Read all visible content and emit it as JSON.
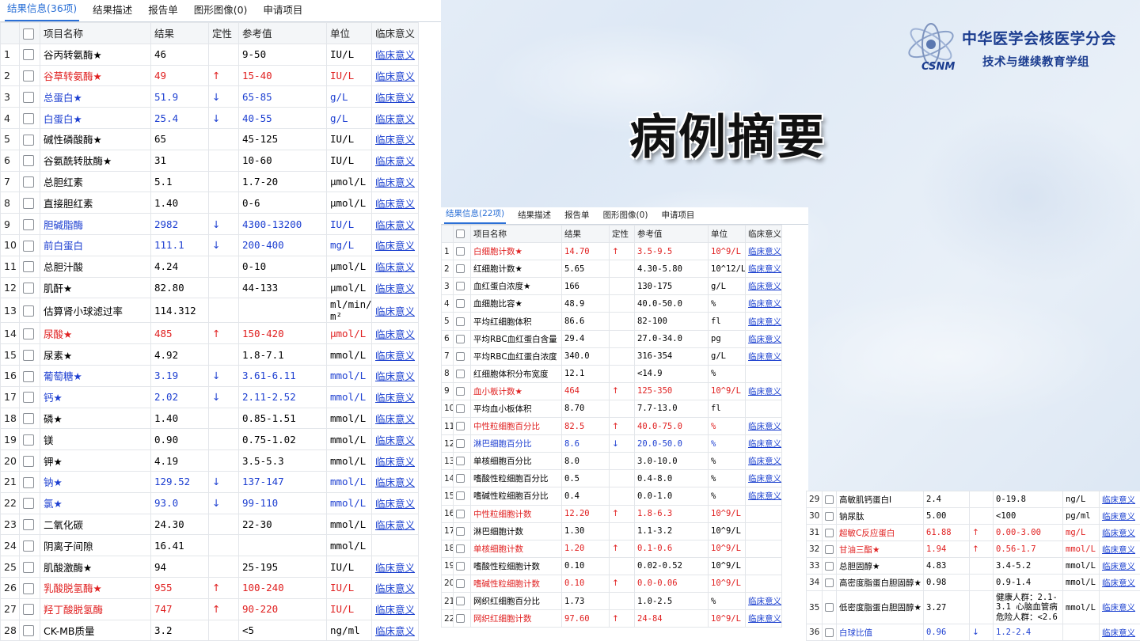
{
  "slide": {
    "title": "病例摘要",
    "org_line1": "中华医学会核医学分会",
    "org_line2": "技术与继续教育学组",
    "logo_text": "CSNM"
  },
  "p1": {
    "tabs": [
      "结果信息(36项)",
      "结果描述",
      "报告单",
      "图形图像(0)",
      "申请项目"
    ],
    "headers": [
      "项目名称",
      "结果",
      "定性",
      "参考值",
      "单位",
      "临床意义"
    ],
    "rows": [
      {
        "n": "1",
        "name": "谷丙转氨酶★",
        "result": "46",
        "flag": "",
        "ref": "9-50",
        "unit": "IU/L",
        "link": "临床意义",
        "color": ""
      },
      {
        "n": "2",
        "name": "谷草转氨酶★",
        "result": "49",
        "flag": "↑",
        "ref": "15-40",
        "unit": "IU/L",
        "link": "临床意义",
        "color": "red"
      },
      {
        "n": "3",
        "name": "总蛋白★",
        "result": "51.9",
        "flag": "↓",
        "ref": "65-85",
        "unit": "g/L",
        "link": "临床意义",
        "color": "blue"
      },
      {
        "n": "4",
        "name": "白蛋白★",
        "result": "25.4",
        "flag": "↓",
        "ref": "40-55",
        "unit": "g/L",
        "link": "临床意义",
        "color": "blue"
      },
      {
        "n": "5",
        "name": "碱性磷酸酶★",
        "result": "65",
        "flag": "",
        "ref": "45-125",
        "unit": "IU/L",
        "link": "临床意义",
        "color": ""
      },
      {
        "n": "6",
        "name": "谷氨酰转肽酶★",
        "result": "31",
        "flag": "",
        "ref": "10-60",
        "unit": "IU/L",
        "link": "临床意义",
        "color": ""
      },
      {
        "n": "7",
        "name": "总胆红素",
        "result": "5.1",
        "flag": "",
        "ref": "1.7-20",
        "unit": "μmol/L",
        "link": "临床意义",
        "color": ""
      },
      {
        "n": "8",
        "name": "直接胆红素",
        "result": "1.40",
        "flag": "",
        "ref": "0-6",
        "unit": "μmol/L",
        "link": "临床意义",
        "color": ""
      },
      {
        "n": "9",
        "name": "胆碱脂酶",
        "result": "2982",
        "flag": "↓",
        "ref": "4300-13200",
        "unit": "IU/L",
        "link": "临床意义",
        "color": "blue"
      },
      {
        "n": "10",
        "name": "前白蛋白",
        "result": "111.1",
        "flag": "↓",
        "ref": "200-400",
        "unit": "mg/L",
        "link": "临床意义",
        "color": "blue"
      },
      {
        "n": "11",
        "name": "总胆汁酸",
        "result": "4.24",
        "flag": "",
        "ref": "0-10",
        "unit": "μmol/L",
        "link": "临床意义",
        "color": ""
      },
      {
        "n": "12",
        "name": "肌酐★",
        "result": "82.80",
        "flag": "",
        "ref": "44-133",
        "unit": "μmol/L",
        "link": "临床意义",
        "color": ""
      },
      {
        "n": "13",
        "name": "估算肾小球滤过率",
        "result": "114.312",
        "flag": "",
        "ref": "",
        "unit": "ml/min/1 m²",
        "link": "临床意义",
        "color": ""
      },
      {
        "n": "14",
        "name": "尿酸★",
        "result": "485",
        "flag": "↑",
        "ref": "150-420",
        "unit": "μmol/L",
        "link": "临床意义",
        "color": "red"
      },
      {
        "n": "15",
        "name": "尿素★",
        "result": "4.92",
        "flag": "",
        "ref": "1.8-7.1",
        "unit": "mmol/L",
        "link": "临床意义",
        "color": ""
      },
      {
        "n": "16",
        "name": "葡萄糖★",
        "result": "3.19",
        "flag": "↓",
        "ref": "3.61-6.11",
        "unit": "mmol/L",
        "link": "临床意义",
        "color": "blue"
      },
      {
        "n": "17",
        "name": "钙★",
        "result": "2.02",
        "flag": "↓",
        "ref": "2.11-2.52",
        "unit": "mmol/L",
        "link": "临床意义",
        "color": "blue"
      },
      {
        "n": "18",
        "name": "磷★",
        "result": "1.40",
        "flag": "",
        "ref": "0.85-1.51",
        "unit": "mmol/L",
        "link": "临床意义",
        "color": ""
      },
      {
        "n": "19",
        "name": "镁",
        "result": "0.90",
        "flag": "",
        "ref": "0.75-1.02",
        "unit": "mmol/L",
        "link": "临床意义",
        "color": ""
      },
      {
        "n": "20",
        "name": "钾★",
        "result": "4.19",
        "flag": "",
        "ref": "3.5-5.3",
        "unit": "mmol/L",
        "link": "临床意义",
        "color": ""
      },
      {
        "n": "21",
        "name": "钠★",
        "result": "129.52",
        "flag": "↓",
        "ref": "137-147",
        "unit": "mmol/L",
        "link": "临床意义",
        "color": "blue"
      },
      {
        "n": "22",
        "name": "氯★",
        "result": "93.0",
        "flag": "↓",
        "ref": "99-110",
        "unit": "mmol/L",
        "link": "临床意义",
        "color": "blue"
      },
      {
        "n": "23",
        "name": "二氧化碳",
        "result": "24.30",
        "flag": "",
        "ref": "22-30",
        "unit": "mmol/L",
        "link": "临床意义",
        "color": ""
      },
      {
        "n": "24",
        "name": "阴离子间隙",
        "result": "16.41",
        "flag": "",
        "ref": "",
        "unit": "mmol/L",
        "link": "",
        "color": ""
      },
      {
        "n": "25",
        "name": "肌酸激酶★",
        "result": "94",
        "flag": "",
        "ref": "25-195",
        "unit": "IU/L",
        "link": "临床意义",
        "color": ""
      },
      {
        "n": "26",
        "name": "乳酸脱氢酶★",
        "result": "955",
        "flag": "↑",
        "ref": "100-240",
        "unit": "IU/L",
        "link": "临床意义",
        "color": "red"
      },
      {
        "n": "27",
        "name": "羟丁酸脱氢酶",
        "result": "747",
        "flag": "↑",
        "ref": "90-220",
        "unit": "IU/L",
        "link": "临床意义",
        "color": "red"
      },
      {
        "n": "28",
        "name": "CK-MB质量",
        "result": "3.2",
        "flag": "",
        "ref": "<5",
        "unit": "ng/ml",
        "link": "临床意义",
        "color": ""
      }
    ]
  },
  "p2": {
    "tabs": [
      "结果信息(22项)",
      "结果描述",
      "报告单",
      "图形图像(0)",
      "申请项目"
    ],
    "headers": [
      "项目名称",
      "结果",
      "定性",
      "参考值",
      "单位",
      "临床意义"
    ],
    "rows": [
      {
        "n": "1",
        "name": "白细胞计数★",
        "result": "14.70",
        "flag": "↑",
        "ref": "3.5-9.5",
        "unit": "10^9/L",
        "link": "临床意义",
        "color": "red"
      },
      {
        "n": "2",
        "name": "红细胞计数★",
        "result": "5.65",
        "flag": "",
        "ref": "4.30-5.80",
        "unit": "10^12/L",
        "link": "临床意义",
        "color": ""
      },
      {
        "n": "3",
        "name": "血红蛋白浓度★",
        "result": "166",
        "flag": "",
        "ref": "130-175",
        "unit": "g/L",
        "link": "临床意义",
        "color": ""
      },
      {
        "n": "4",
        "name": "血细胞比容★",
        "result": "48.9",
        "flag": "",
        "ref": "40.0-50.0",
        "unit": "%",
        "link": "临床意义",
        "color": ""
      },
      {
        "n": "5",
        "name": "平均红细胞体积",
        "result": "86.6",
        "flag": "",
        "ref": "82-100",
        "unit": "fl",
        "link": "临床意义",
        "color": ""
      },
      {
        "n": "6",
        "name": "平均RBC血红蛋白含量",
        "result": "29.4",
        "flag": "",
        "ref": "27.0-34.0",
        "unit": "pg",
        "link": "临床意义",
        "color": ""
      },
      {
        "n": "7",
        "name": "平均RBC血红蛋白浓度",
        "result": "340.0",
        "flag": "",
        "ref": "316-354",
        "unit": "g/L",
        "link": "临床意义",
        "color": ""
      },
      {
        "n": "8",
        "name": "红细胞体积分布宽度",
        "result": "12.1",
        "flag": "",
        "ref": "<14.9",
        "unit": "%",
        "link": "",
        "color": ""
      },
      {
        "n": "9",
        "name": "血小板计数★",
        "result": "464",
        "flag": "↑",
        "ref": "125-350",
        "unit": "10^9/L",
        "link": "临床意义",
        "color": "red"
      },
      {
        "n": "10",
        "name": "平均血小板体积",
        "result": "8.70",
        "flag": "",
        "ref": "7.7-13.0",
        "unit": "fl",
        "link": "",
        "color": ""
      },
      {
        "n": "11",
        "name": "中性粒细胞百分比",
        "result": "82.5",
        "flag": "↑",
        "ref": "40.0-75.0",
        "unit": "%",
        "link": "临床意义",
        "color": "red"
      },
      {
        "n": "12",
        "name": "淋巴细胞百分比",
        "result": "8.6",
        "flag": "↓",
        "ref": "20.0-50.0",
        "unit": "%",
        "link": "临床意义",
        "color": "blue"
      },
      {
        "n": "13",
        "name": "单核细胞百分比",
        "result": "8.0",
        "flag": "",
        "ref": "3.0-10.0",
        "unit": "%",
        "link": "临床意义",
        "color": ""
      },
      {
        "n": "14",
        "name": "嗜酸性粒细胞百分比",
        "result": "0.5",
        "flag": "",
        "ref": "0.4-8.0",
        "unit": "%",
        "link": "临床意义",
        "color": ""
      },
      {
        "n": "15",
        "name": "嗜碱性粒细胞百分比",
        "result": "0.4",
        "flag": "",
        "ref": "0.0-1.0",
        "unit": "%",
        "link": "临床意义",
        "color": ""
      },
      {
        "n": "16",
        "name": "中性粒细胞计数",
        "result": "12.20",
        "flag": "↑",
        "ref": "1.8-6.3",
        "unit": "10^9/L",
        "link": "",
        "color": "red"
      },
      {
        "n": "17",
        "name": "淋巴细胞计数",
        "result": "1.30",
        "flag": "",
        "ref": "1.1-3.2",
        "unit": "10^9/L",
        "link": "",
        "color": ""
      },
      {
        "n": "18",
        "name": "单核细胞计数",
        "result": "1.20",
        "flag": "↑",
        "ref": "0.1-0.6",
        "unit": "10^9/L",
        "link": "",
        "color": "red"
      },
      {
        "n": "19",
        "name": "嗜酸性粒细胞计数",
        "result": "0.10",
        "flag": "",
        "ref": "0.02-0.52",
        "unit": "10^9/L",
        "link": "",
        "color": ""
      },
      {
        "n": "20",
        "name": "嗜碱性粒细胞计数",
        "result": "0.10",
        "flag": "↑",
        "ref": "0.0-0.06",
        "unit": "10^9/L",
        "link": "",
        "color": "red"
      },
      {
        "n": "21",
        "name": "网织红细胞百分比",
        "result": "1.73",
        "flag": "",
        "ref": "1.0-2.5",
        "unit": "%",
        "link": "临床意义",
        "color": ""
      },
      {
        "n": "22",
        "name": "网织红细胞计数",
        "result": "97.60",
        "flag": "↑",
        "ref": "24-84",
        "unit": "10^9/L",
        "link": "临床意义",
        "color": "red"
      }
    ]
  },
  "p3": {
    "rows": [
      {
        "n": "29",
        "name": "高敏肌钙蛋白I",
        "result": "2.4",
        "flag": "",
        "ref": "0-19.8",
        "unit": "ng/L",
        "link": "临床意义",
        "color": ""
      },
      {
        "n": "30",
        "name": "钠尿肽",
        "result": "5.00",
        "flag": "",
        "ref": "<100",
        "unit": "pg/ml",
        "link": "临床意义",
        "color": ""
      },
      {
        "n": "31",
        "name": "超敏C反应蛋白",
        "result": "61.88",
        "flag": "↑",
        "ref": "0.00-3.00",
        "unit": "mg/L",
        "link": "临床意义",
        "color": "red"
      },
      {
        "n": "32",
        "name": "甘油三酯★",
        "result": "1.94",
        "flag": "↑",
        "ref": "0.56-1.7",
        "unit": "mmol/L",
        "link": "临床意义",
        "color": "red"
      },
      {
        "n": "33",
        "name": "总胆固醇★",
        "result": "4.83",
        "flag": "",
        "ref": "3.4-5.2",
        "unit": "mmol/L",
        "link": "临床意义",
        "color": ""
      },
      {
        "n": "34",
        "name": "高密度脂蛋白胆固醇★",
        "result": "0.98",
        "flag": "",
        "ref": "0.9-1.4",
        "unit": "mmol/L",
        "link": "临床意义",
        "color": ""
      },
      {
        "n": "35",
        "name": "低密度脂蛋白胆固醇★",
        "result": "3.27",
        "flag": "",
        "ref": "健康人群：2.1-3.1 心脑血管病危险人群：<2.6",
        "unit": "mmol/L",
        "link": "临床意义",
        "color": "",
        "tall": true
      },
      {
        "n": "36",
        "name": "白球比值",
        "result": "0.96",
        "flag": "↓",
        "ref": "1.2-2.4",
        "unit": "",
        "link": "临床意义",
        "color": "blue"
      }
    ]
  },
  "colors": {
    "red": "#e02020",
    "blue": "#1d3fd1",
    "link": "#1a3fcf",
    "tab_active": "#2a6fd6"
  }
}
